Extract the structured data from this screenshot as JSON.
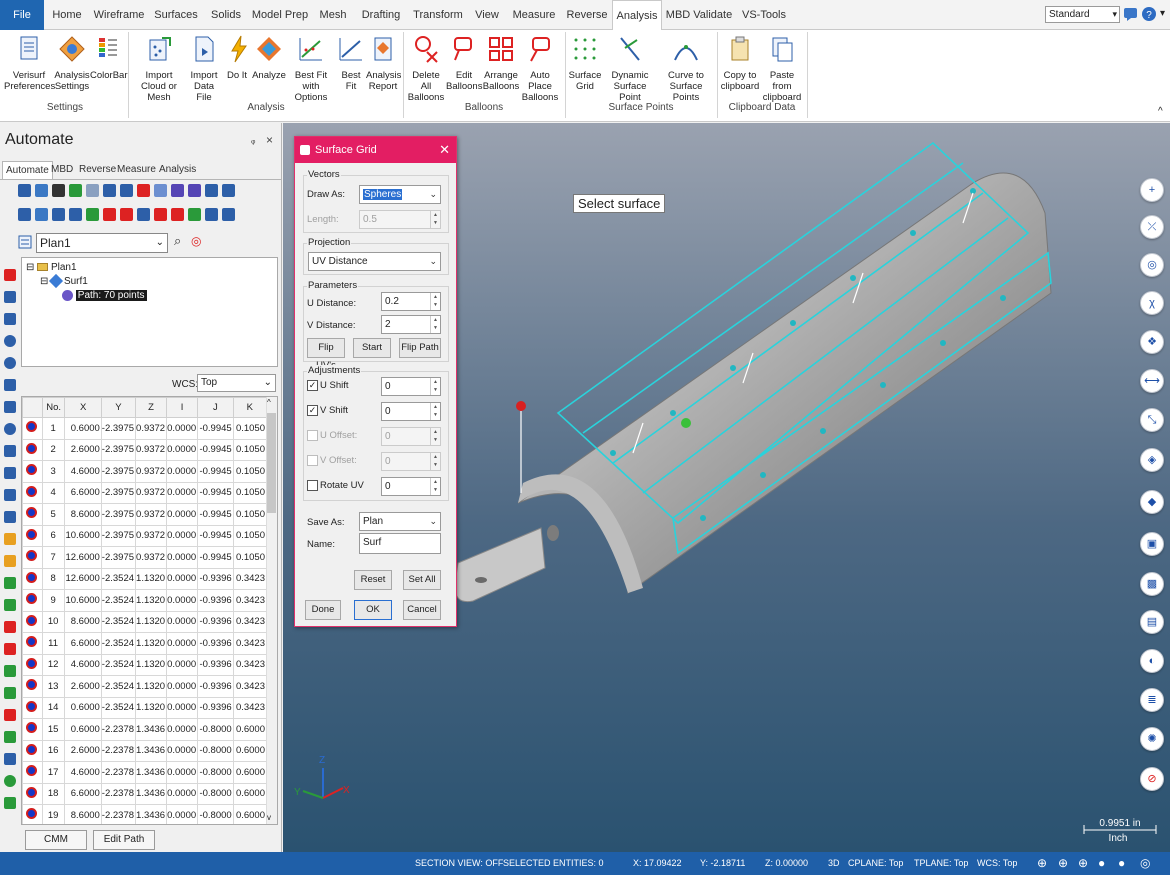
{
  "ribbon_tabs": [
    "File",
    "Home",
    "Wireframe",
    "Surfaces",
    "Solids",
    "Model Prep",
    "Mesh",
    "Drafting",
    "Transform",
    "View",
    "Measure",
    "Reverse",
    "Analysis",
    "MBD Validate",
    "VS-Tools"
  ],
  "active_tab": "Analysis",
  "style_select": "Standard",
  "ribbon_groups": {
    "settings": {
      "label": "Settings",
      "buttons": [
        "Verisurf Preferences",
        "Analysis Settings",
        "ColorBar"
      ]
    },
    "analysis": {
      "label": "Analysis",
      "buttons": [
        "Import Cloud or Mesh",
        "Import Data File",
        "Do It",
        "Analyze",
        "Best Fit with Options",
        "Best Fit",
        "Analysis Report"
      ]
    },
    "balloons": {
      "label": "Balloons",
      "buttons": [
        "Delete All Balloons",
        "Edit Balloons",
        "Arrange Balloons",
        "Auto Place Balloons"
      ]
    },
    "surface_points": {
      "label": "Surface Points",
      "buttons": [
        "Surface Grid",
        "Dynamic Surface Point",
        "Curve to Surface Points"
      ]
    },
    "clipboard": {
      "label": "Clipboard Data",
      "buttons": [
        "Copy to clipboard",
        "Paste from clipboard"
      ]
    }
  },
  "panel": {
    "title": "Automate",
    "tabs": [
      "Automate",
      "MBD",
      "Reverse",
      "Measure",
      "Analysis"
    ],
    "plan_select": "Plan1",
    "tree": {
      "root": "Plan1",
      "child": "Surf1",
      "leaf": "Path: 70 points"
    },
    "wcs_label": "WCS:",
    "wcs_value": "Top",
    "columns": [
      "No.",
      "X",
      "Y",
      "Z",
      "I",
      "J",
      "K"
    ],
    "rows": [
      [
        "1",
        "0.6000",
        "-2.3975",
        "0.9372",
        "0.0000",
        "-0.9945",
        "0.1050"
      ],
      [
        "2",
        "2.6000",
        "-2.3975",
        "0.9372",
        "0.0000",
        "-0.9945",
        "0.1050"
      ],
      [
        "3",
        "4.6000",
        "-2.3975",
        "0.9372",
        "0.0000",
        "-0.9945",
        "0.1050"
      ],
      [
        "4",
        "6.6000",
        "-2.3975",
        "0.9372",
        "0.0000",
        "-0.9945",
        "0.1050"
      ],
      [
        "5",
        "8.6000",
        "-2.3975",
        "0.9372",
        "0.0000",
        "-0.9945",
        "0.1050"
      ],
      [
        "6",
        "10.6000",
        "-2.3975",
        "0.9372",
        "0.0000",
        "-0.9945",
        "0.1050"
      ],
      [
        "7",
        "12.6000",
        "-2.3975",
        "0.9372",
        "0.0000",
        "-0.9945",
        "0.1050"
      ],
      [
        "8",
        "12.6000",
        "-2.3524",
        "1.1320",
        "0.0000",
        "-0.9396",
        "0.3423"
      ],
      [
        "9",
        "10.6000",
        "-2.3524",
        "1.1320",
        "0.0000",
        "-0.9396",
        "0.3423"
      ],
      [
        "10",
        "8.6000",
        "-2.3524",
        "1.1320",
        "0.0000",
        "-0.9396",
        "0.3423"
      ],
      [
        "11",
        "6.6000",
        "-2.3524",
        "1.1320",
        "0.0000",
        "-0.9396",
        "0.3423"
      ],
      [
        "12",
        "4.6000",
        "-2.3524",
        "1.1320",
        "0.0000",
        "-0.9396",
        "0.3423"
      ],
      [
        "13",
        "2.6000",
        "-2.3524",
        "1.1320",
        "0.0000",
        "-0.9396",
        "0.3423"
      ],
      [
        "14",
        "0.6000",
        "-2.3524",
        "1.1320",
        "0.0000",
        "-0.9396",
        "0.3423"
      ],
      [
        "15",
        "0.6000",
        "-2.2378",
        "1.3436",
        "0.0000",
        "-0.8000",
        "0.6000"
      ],
      [
        "16",
        "2.6000",
        "-2.2378",
        "1.3436",
        "0.0000",
        "-0.8000",
        "0.6000"
      ],
      [
        "17",
        "4.6000",
        "-2.2378",
        "1.3436",
        "0.0000",
        "-0.8000",
        "0.6000"
      ],
      [
        "18",
        "6.6000",
        "-2.2378",
        "1.3436",
        "0.0000",
        "-0.8000",
        "0.6000"
      ],
      [
        "19",
        "8.6000",
        "-2.2378",
        "1.3436",
        "0.0000",
        "-0.8000",
        "0.6000"
      ]
    ],
    "cmm_button": "CMM Settings",
    "edit_path_button": "Edit Path"
  },
  "dialog": {
    "title": "Surface Grid",
    "vectors_label": "Vectors",
    "draw_as_label": "Draw As:",
    "draw_as_value": "Spheres",
    "length_label": "Length:",
    "length_value": "0.5",
    "projection_label": "Projection",
    "projection_value": "UV Distance",
    "parameters_label": "Parameters",
    "u_distance_label": "U Distance:",
    "u_distance_value": "0.2",
    "v_distance_label": "V Distance:",
    "v_distance_value": "2",
    "flip_uvs": "Flip UV's",
    "start": "Start",
    "flip_path": "Flip Path",
    "adjustments_label": "Adjustments",
    "u_shift_label": "U Shift",
    "u_shift_value": "0",
    "v_shift_label": "V Shift",
    "v_shift_value": "0",
    "u_offset_label": "U Offset:",
    "u_offset_value": "0",
    "v_offset_label": "V Offset:",
    "v_offset_value": "0",
    "rotate_uv_label": "Rotate UV",
    "rotate_uv_value": "0",
    "save_as_label": "Save As:",
    "save_as_value": "Plan",
    "name_label": "Name:",
    "name_value": "Surf",
    "reset": "Reset",
    "set_all": "Set All",
    "done": "Done",
    "ok": "OK",
    "cancel": "Cancel"
  },
  "viewport": {
    "prompt": "Select surface",
    "scale_value": "0.9951 in",
    "scale_unit": "Inch",
    "axis_z": "Z",
    "axis_y": "Y",
    "axis_x": "X"
  },
  "status": {
    "section_view": "SECTION VIEW: OFF",
    "selected": "SELECTED ENTITIES: 0",
    "x": "X:  17.09422",
    "y": "Y:  -2.18711",
    "z": "Z:  0.00000",
    "mode": "3D",
    "cplane": "CPLANE: Top",
    "tplane": "TPLANE: Top",
    "wcs": "WCS: Top"
  },
  "colors": {
    "accent": "#e31e63",
    "file_tab": "#1f66b1",
    "statusbar": "#1f5fa8",
    "grid_cyan": "#29d3dc"
  }
}
